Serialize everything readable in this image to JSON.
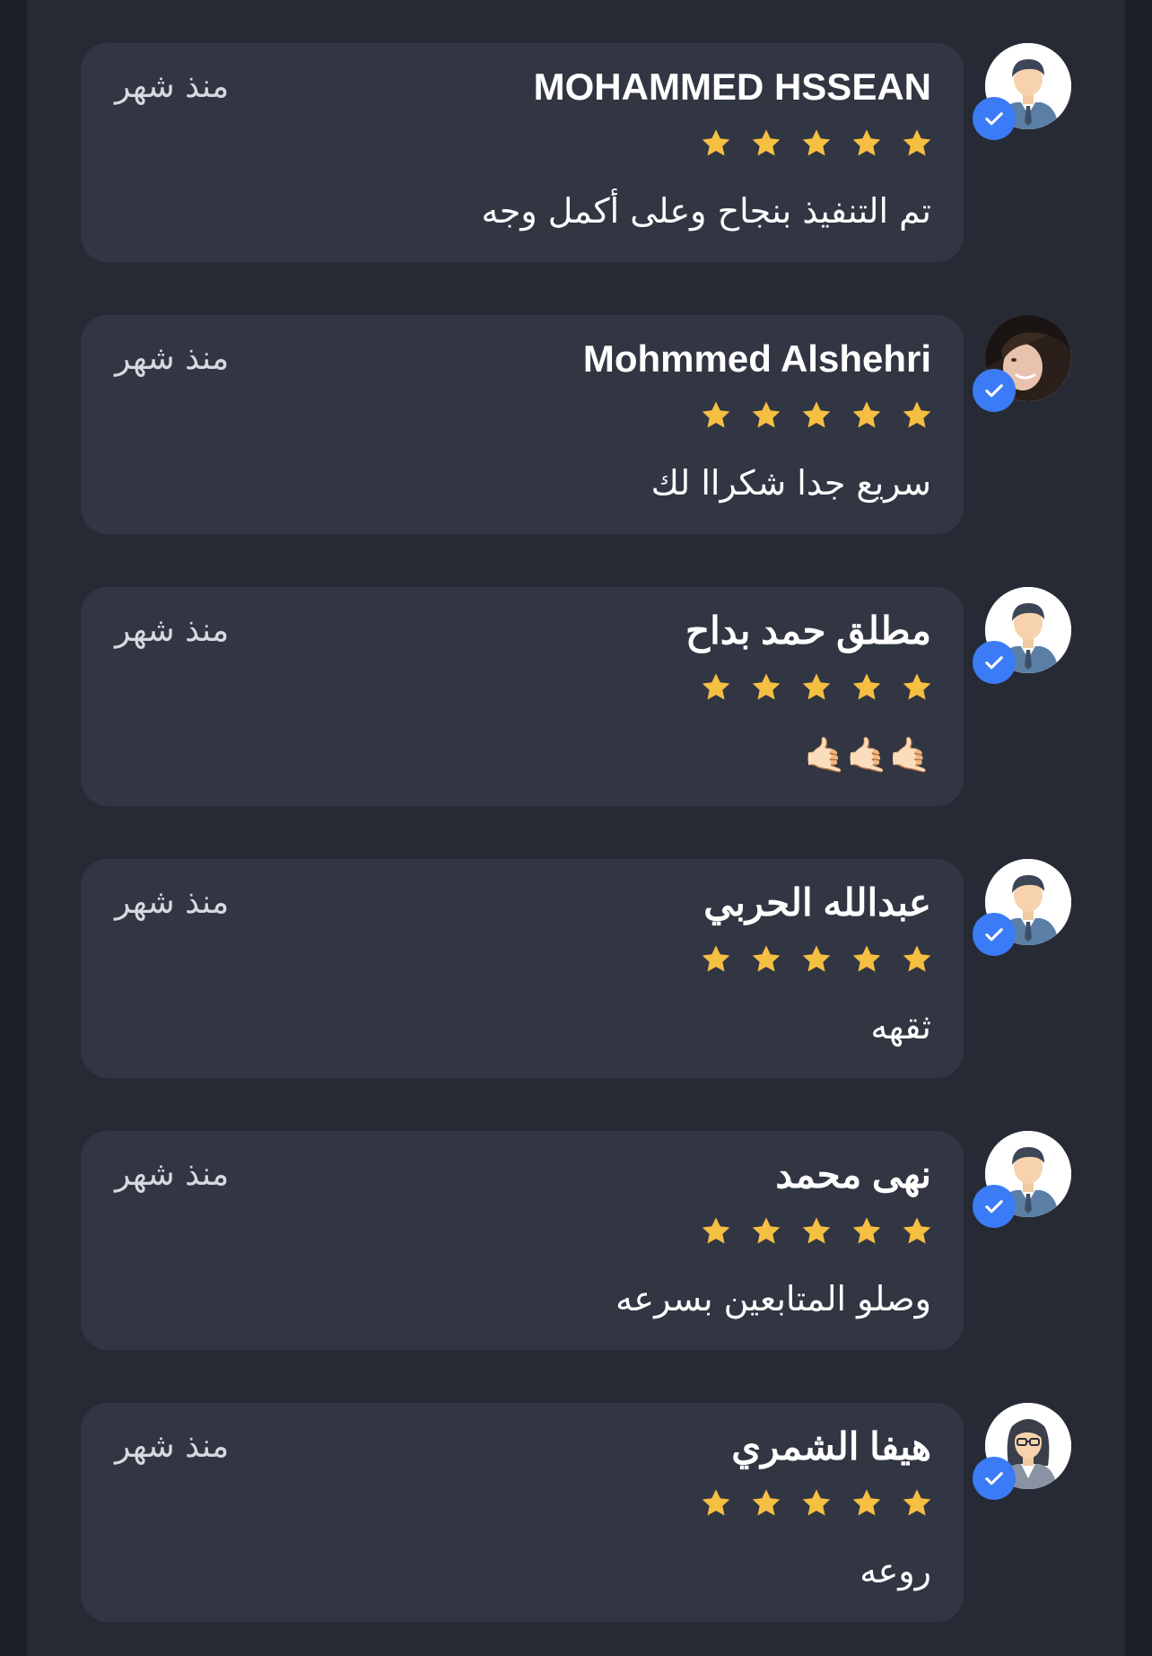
{
  "colors": {
    "page_background": "#1c1f27",
    "panel_background": "#262a35",
    "card_background": "#323643",
    "star": "#f5bf42",
    "verified_badge": "#3b7cf6"
  },
  "reviews": [
    {
      "name": "MOHAMMED HSSEAN",
      "time": "منذ شهر",
      "rating": 5,
      "comment": "تم التنفيذ بنجاح وعلى أكمل وجه",
      "avatar_icon": "male-avatar-icon",
      "verified": true
    },
    {
      "name": "Mohmmed Alshehri",
      "time": "منذ شهر",
      "rating": 5,
      "comment": "سريع جدا شكراا لك",
      "avatar_icon": "profile-photo",
      "verified": true
    },
    {
      "name": "مطلق حمد بداح",
      "time": "منذ شهر",
      "rating": 5,
      "comment": "🤙🏻🤙🏻🤙🏻",
      "avatar_icon": "male-avatar-icon",
      "verified": true
    },
    {
      "name": "عبدالله الحربي",
      "time": "منذ شهر",
      "rating": 5,
      "comment": "ثقهه",
      "avatar_icon": "male-avatar-icon",
      "verified": true
    },
    {
      "name": "نهى محمد",
      "time": "منذ شهر",
      "rating": 5,
      "comment": "وصلو المتابعين بسرعه",
      "avatar_icon": "male-avatar-icon",
      "verified": true
    },
    {
      "name": "هيفا الشمري",
      "time": "منذ شهر",
      "rating": 5,
      "comment": "روعه",
      "avatar_icon": "female-avatar-icon",
      "verified": true
    }
  ]
}
